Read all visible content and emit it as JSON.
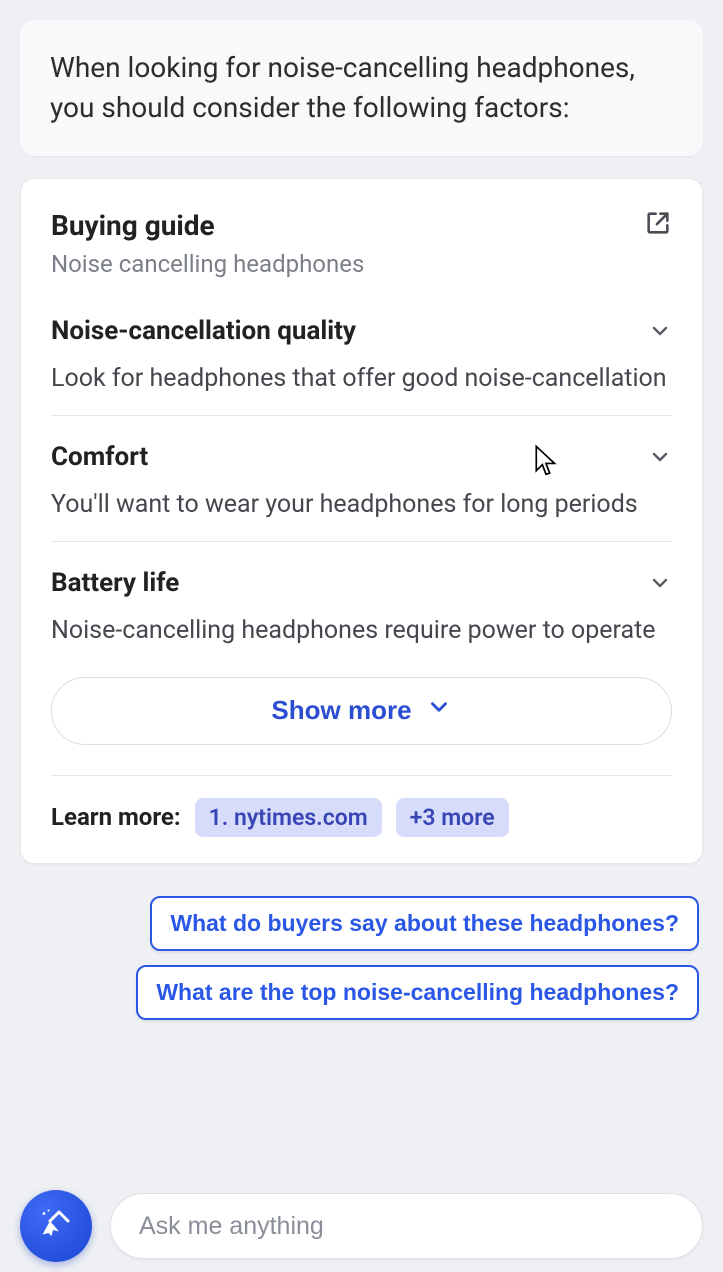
{
  "intro": "When looking for noise-cancelling headphones, you should consider the following factors:",
  "guide": {
    "title": "Buying guide",
    "subtitle": "Noise cancelling headphones",
    "sections": [
      {
        "title": "Noise-cancellation quality",
        "body": "Look for headphones that offer good noise-cancellation"
      },
      {
        "title": "Comfort",
        "body": "You'll want to wear your headphones for long periods"
      },
      {
        "title": "Battery life",
        "body": "Noise-cancelling headphones require power to operate"
      }
    ],
    "show_more": "Show more",
    "learn_label": "Learn more:",
    "sources": [
      {
        "label": "1. nytimes.com"
      },
      {
        "label": "+3 more"
      }
    ]
  },
  "suggestions": [
    "What do buyers say about these headphones?",
    "What are the top noise-cancelling headphones?"
  ],
  "composer": {
    "placeholder": "Ask me anything"
  }
}
